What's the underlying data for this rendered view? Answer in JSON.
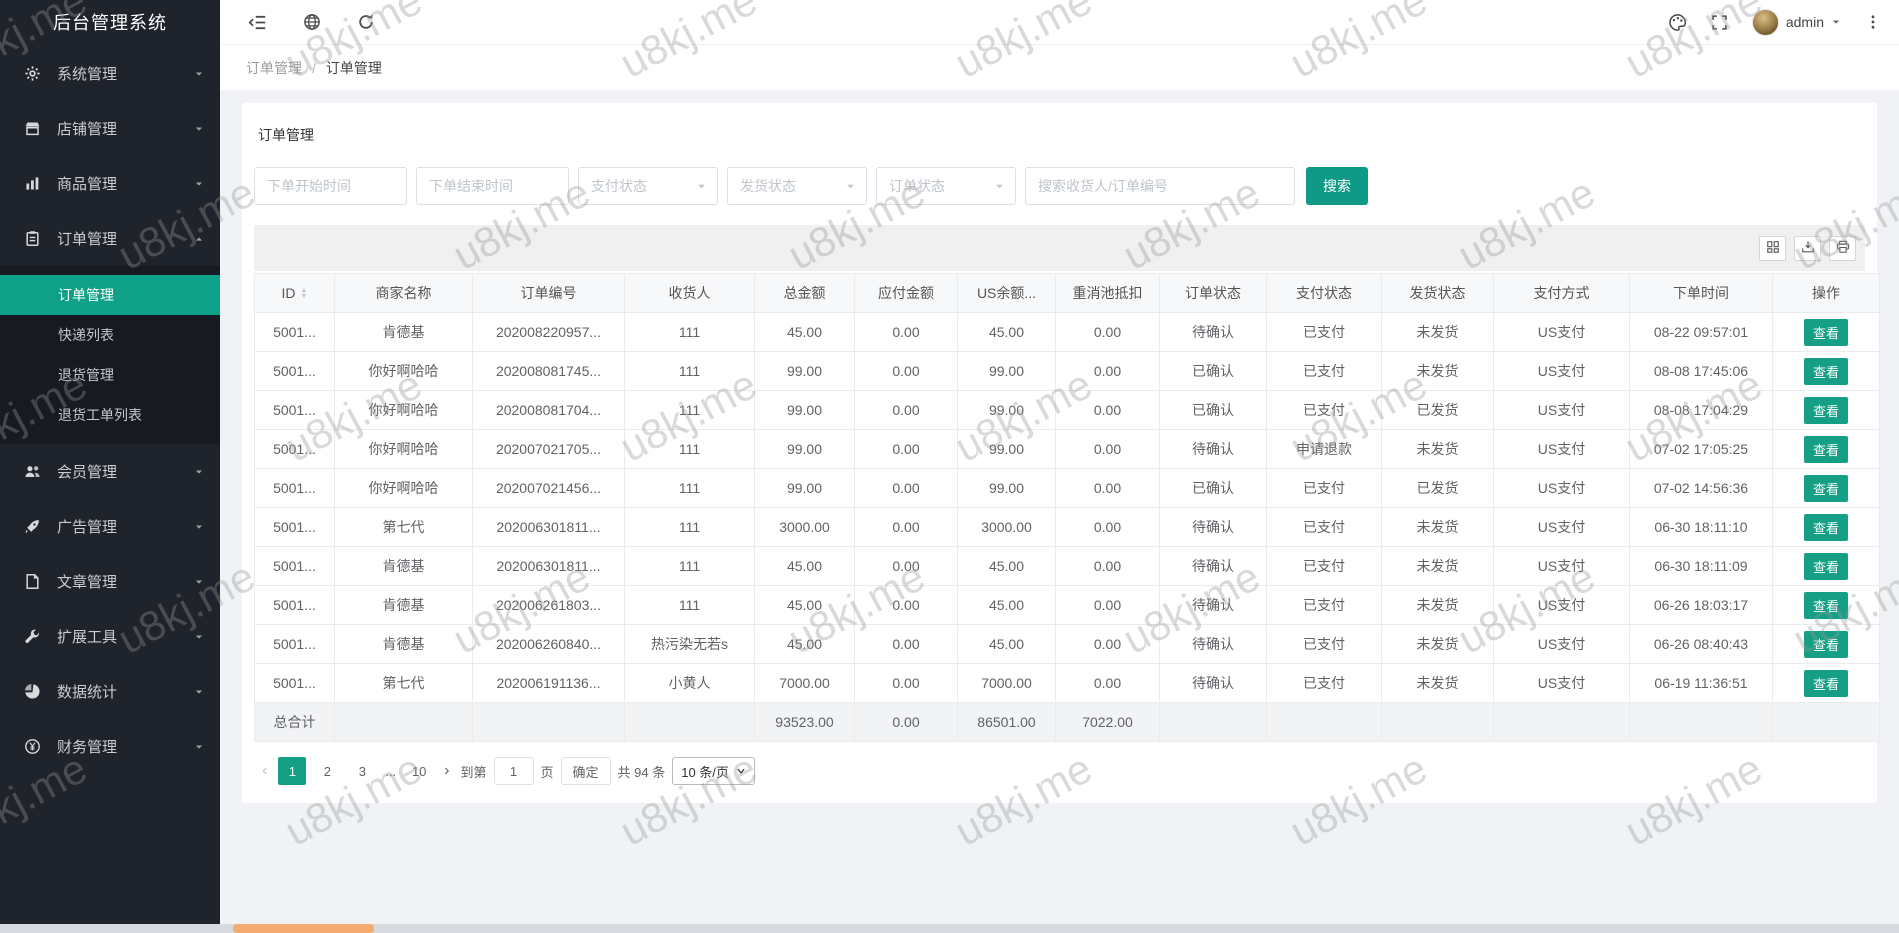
{
  "app": {
    "title": "后台管理系统"
  },
  "topbar": {
    "user": "admin"
  },
  "breadcrumb": {
    "parent": "订单管理",
    "sep": "/",
    "current": "订单管理"
  },
  "page": {
    "card_title": "订单管理"
  },
  "filters": {
    "start_placeholder": "下单开始时间",
    "end_placeholder": "下单结束时间",
    "pay_status": "支付状态",
    "ship_status": "发货状态",
    "order_status": "订单状态",
    "search_placeholder": "搜索收货人/订单编号",
    "search_button": "搜索"
  },
  "sidebar": {
    "items": [
      {
        "label": "系统管理",
        "icon": "gear"
      },
      {
        "label": "店铺管理",
        "icon": "shop"
      },
      {
        "label": "商品管理",
        "icon": "chart"
      },
      {
        "label": "订单管理",
        "icon": "order",
        "expanded": true,
        "children": [
          {
            "label": "订单管理",
            "active": true
          },
          {
            "label": "快递列表"
          },
          {
            "label": "退货管理"
          },
          {
            "label": "退货工单列表"
          }
        ]
      },
      {
        "label": "会员管理",
        "icon": "users"
      },
      {
        "label": "广告管理",
        "icon": "rocket"
      },
      {
        "label": "文章管理",
        "icon": "article"
      },
      {
        "label": "扩展工具",
        "icon": "wrench"
      },
      {
        "label": "数据统计",
        "icon": "pie"
      },
      {
        "label": "财务管理",
        "icon": "finance"
      }
    ]
  },
  "table": {
    "columns": [
      "ID",
      "商家名称",
      "订单编号",
      "收货人",
      "总金额",
      "应付金额",
      "US余额...",
      "重消池抵扣",
      "订单状态",
      "支付状态",
      "发货状态",
      "支付方式",
      "下单时间",
      "操作"
    ],
    "action_label": "查看",
    "rows": [
      [
        "5001...",
        "肯德基",
        "202008220957...",
        "111",
        "45.00",
        "0.00",
        "45.00",
        "0.00",
        "待确认",
        "已支付",
        "未发货",
        "US支付",
        "08-22 09:57:01"
      ],
      [
        "5001...",
        "你好啊哈哈",
        "202008081745...",
        "111",
        "99.00",
        "0.00",
        "99.00",
        "0.00",
        "已确认",
        "已支付",
        "未发货",
        "US支付",
        "08-08 17:45:06"
      ],
      [
        "5001...",
        "你好啊哈哈",
        "202008081704...",
        "111",
        "99.00",
        "0.00",
        "99.00",
        "0.00",
        "已确认",
        "已支付",
        "已发货",
        "US支付",
        "08-08 17:04:29"
      ],
      [
        "5001...",
        "你好啊哈哈",
        "202007021705...",
        "111",
        "99.00",
        "0.00",
        "99.00",
        "0.00",
        "待确认",
        "申请退款",
        "未发货",
        "US支付",
        "07-02 17:05:25"
      ],
      [
        "5001...",
        "你好啊哈哈",
        "202007021456...",
        "111",
        "99.00",
        "0.00",
        "99.00",
        "0.00",
        "已确认",
        "已支付",
        "已发货",
        "US支付",
        "07-02 14:56:36"
      ],
      [
        "5001...",
        "第七代",
        "202006301811...",
        "111",
        "3000.00",
        "0.00",
        "3000.00",
        "0.00",
        "待确认",
        "已支付",
        "未发货",
        "US支付",
        "06-30 18:11:10"
      ],
      [
        "5001...",
        "肯德基",
        "202006301811...",
        "111",
        "45.00",
        "0.00",
        "45.00",
        "0.00",
        "待确认",
        "已支付",
        "未发货",
        "US支付",
        "06-30 18:11:09"
      ],
      [
        "5001...",
        "肯德基",
        "202006261803...",
        "111",
        "45.00",
        "0.00",
        "45.00",
        "0.00",
        "待确认",
        "已支付",
        "未发货",
        "US支付",
        "06-26 18:03:17"
      ],
      [
        "5001...",
        "肯德基",
        "202006260840...",
        "热污染无若s",
        "45.00",
        "0.00",
        "45.00",
        "0.00",
        "待确认",
        "已支付",
        "未发货",
        "US支付",
        "06-26 08:40:43"
      ],
      [
        "5001...",
        "第七代",
        "202006191136...",
        "小黄人",
        "7000.00",
        "0.00",
        "7000.00",
        "0.00",
        "待确认",
        "已支付",
        "未发货",
        "US支付",
        "06-19 11:36:51"
      ]
    ],
    "totals": {
      "label": "总合计",
      "total": "93523.00",
      "payable": "0.00",
      "us": "86501.00",
      "pool": "7022.00"
    }
  },
  "pagination": {
    "pages": [
      "1",
      "2",
      "3",
      "...",
      "10"
    ],
    "active": "1",
    "goto_prefix": "到第",
    "goto_value": "1",
    "goto_suffix": "页",
    "confirm": "确定",
    "total_text": "共 94 条",
    "per_page": "10 条/页"
  },
  "watermark": {
    "text": "u8kj.me"
  },
  "colors": {
    "accent": "#0e9a87",
    "accent_bright": "#15a086",
    "sidebar_bg": "#1f232b",
    "sidebar_active": "#0fa188",
    "scroll_thumb": "#f3ab6f"
  }
}
